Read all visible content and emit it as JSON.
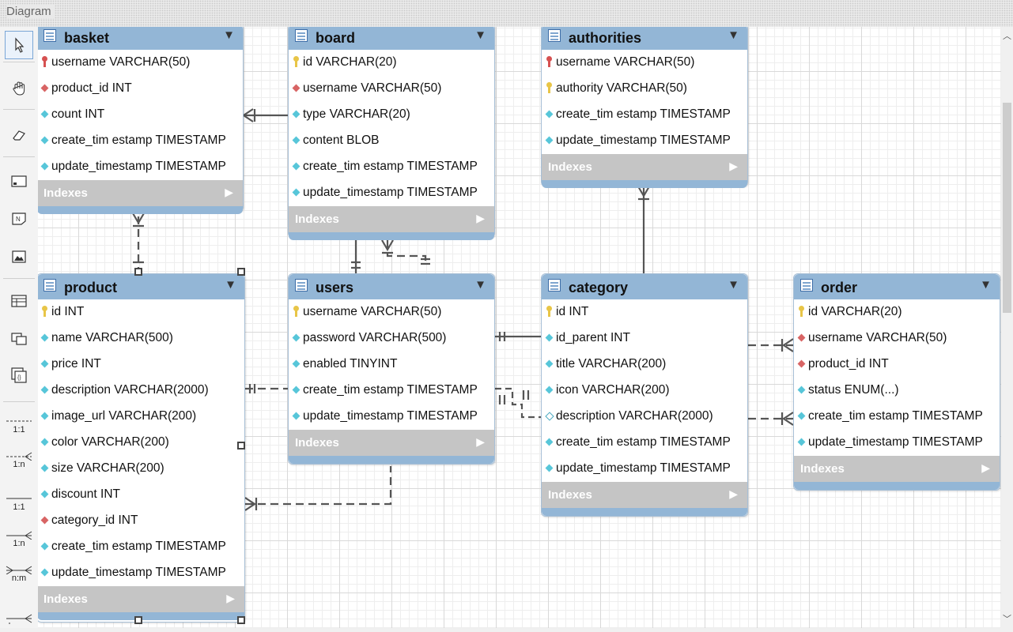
{
  "panel": {
    "title": "Diagram"
  },
  "toolbar": {
    "tools": [
      {
        "name": "select-tool",
        "icon": "pointer-icon"
      },
      {
        "name": "hand-tool",
        "icon": "hand-icon"
      },
      {
        "name": "eraser-tool",
        "icon": "eraser-icon"
      },
      {
        "name": "layer-tool",
        "icon": "layer-icon"
      },
      {
        "name": "note-tool",
        "icon": "note-icon"
      },
      {
        "name": "image-tool",
        "icon": "image-icon"
      },
      {
        "name": "table-tool",
        "icon": "table-icon"
      },
      {
        "name": "view-tool",
        "icon": "view-icon"
      },
      {
        "name": "routine-group-tool",
        "icon": "routine-group-icon"
      }
    ],
    "relationships": [
      {
        "label": "1:1",
        "style": "non-identifying"
      },
      {
        "label": "1:n",
        "style": "non-identifying"
      },
      {
        "label": "1:1",
        "style": "identifying"
      },
      {
        "label": "1:n",
        "style": "identifying"
      },
      {
        "label": "n:m",
        "style": "identifying"
      }
    ]
  },
  "tables": {
    "basket": {
      "name": "basket",
      "indexes_label": "Indexes",
      "columns": [
        {
          "icon": "pkfk",
          "text": "username VARCHAR(50)"
        },
        {
          "icon": "fk",
          "text": "product_id INT"
        },
        {
          "icon": "col",
          "text": "count INT"
        },
        {
          "icon": "col",
          "text": "create_tim estamp TIMESTAMP"
        },
        {
          "icon": "col",
          "text": "update_timestamp TIMESTAMP"
        }
      ]
    },
    "board": {
      "name": "board",
      "indexes_label": "Indexes",
      "columns": [
        {
          "icon": "pk",
          "text": "id VARCHAR(20)"
        },
        {
          "icon": "fk",
          "text": "username VARCHAR(50)"
        },
        {
          "icon": "col",
          "text": "type VARCHAR(20)"
        },
        {
          "icon": "col",
          "text": "content BLOB"
        },
        {
          "icon": "col",
          "text": "create_tim estamp TIMESTAMP"
        },
        {
          "icon": "col",
          "text": "update_timestamp TIMESTAMP"
        }
      ]
    },
    "authorities": {
      "name": "authorities",
      "indexes_label": "Indexes",
      "columns": [
        {
          "icon": "pkfk",
          "text": "username VARCHAR(50)"
        },
        {
          "icon": "pk",
          "text": "authority VARCHAR(50)"
        },
        {
          "icon": "col",
          "text": "create_tim estamp TIMESTAMP"
        },
        {
          "icon": "col",
          "text": "update_timestamp TIMESTAMP"
        }
      ]
    },
    "product": {
      "name": "product",
      "indexes_label": "Indexes",
      "columns": [
        {
          "icon": "pk",
          "text": "id INT"
        },
        {
          "icon": "col",
          "text": "name VARCHAR(500)"
        },
        {
          "icon": "col",
          "text": "price INT"
        },
        {
          "icon": "col",
          "text": "description VARCHAR(2000)"
        },
        {
          "icon": "col",
          "text": "image_url VARCHAR(200)"
        },
        {
          "icon": "col",
          "text": "color VARCHAR(200)"
        },
        {
          "icon": "col",
          "text": "size VARCHAR(200)"
        },
        {
          "icon": "col",
          "text": "discount INT"
        },
        {
          "icon": "fk",
          "text": "category_id INT"
        },
        {
          "icon": "col",
          "text": "create_tim estamp TIMESTAMP"
        },
        {
          "icon": "col",
          "text": "update_timestamp TIMESTAMP"
        }
      ]
    },
    "users": {
      "name": "users",
      "indexes_label": "Indexes",
      "columns": [
        {
          "icon": "pk",
          "text": "username VARCHAR(50)"
        },
        {
          "icon": "col",
          "text": "password VARCHAR(500)"
        },
        {
          "icon": "col",
          "text": "enabled TINYINT"
        },
        {
          "icon": "col",
          "text": "create_tim estamp TIMESTAMP"
        },
        {
          "icon": "col",
          "text": "update_timestamp TIMESTAMP"
        }
      ]
    },
    "category": {
      "name": "category",
      "indexes_label": "Indexes",
      "columns": [
        {
          "icon": "pk",
          "text": "id INT"
        },
        {
          "icon": "col",
          "text": "id_parent INT"
        },
        {
          "icon": "col",
          "text": "title VARCHAR(200)"
        },
        {
          "icon": "col",
          "text": "icon VARCHAR(200)"
        },
        {
          "icon": "hol",
          "text": "description VARCHAR(2000)"
        },
        {
          "icon": "col",
          "text": "create_tim estamp TIMESTAMP"
        },
        {
          "icon": "col",
          "text": "update_timestamp TIMESTAMP"
        }
      ]
    },
    "order": {
      "name": "order",
      "indexes_label": "Indexes",
      "columns": [
        {
          "icon": "pk",
          "text": "id VARCHAR(20)"
        },
        {
          "icon": "fk",
          "text": "username VARCHAR(50)"
        },
        {
          "icon": "fk",
          "text": "product_id INT"
        },
        {
          "icon": "col",
          "text": "status ENUM(...)"
        },
        {
          "icon": "col",
          "text": "create_tim estamp TIMESTAMP"
        },
        {
          "icon": "col",
          "text": "update_timestamp TIMESTAMP"
        }
      ]
    }
  }
}
